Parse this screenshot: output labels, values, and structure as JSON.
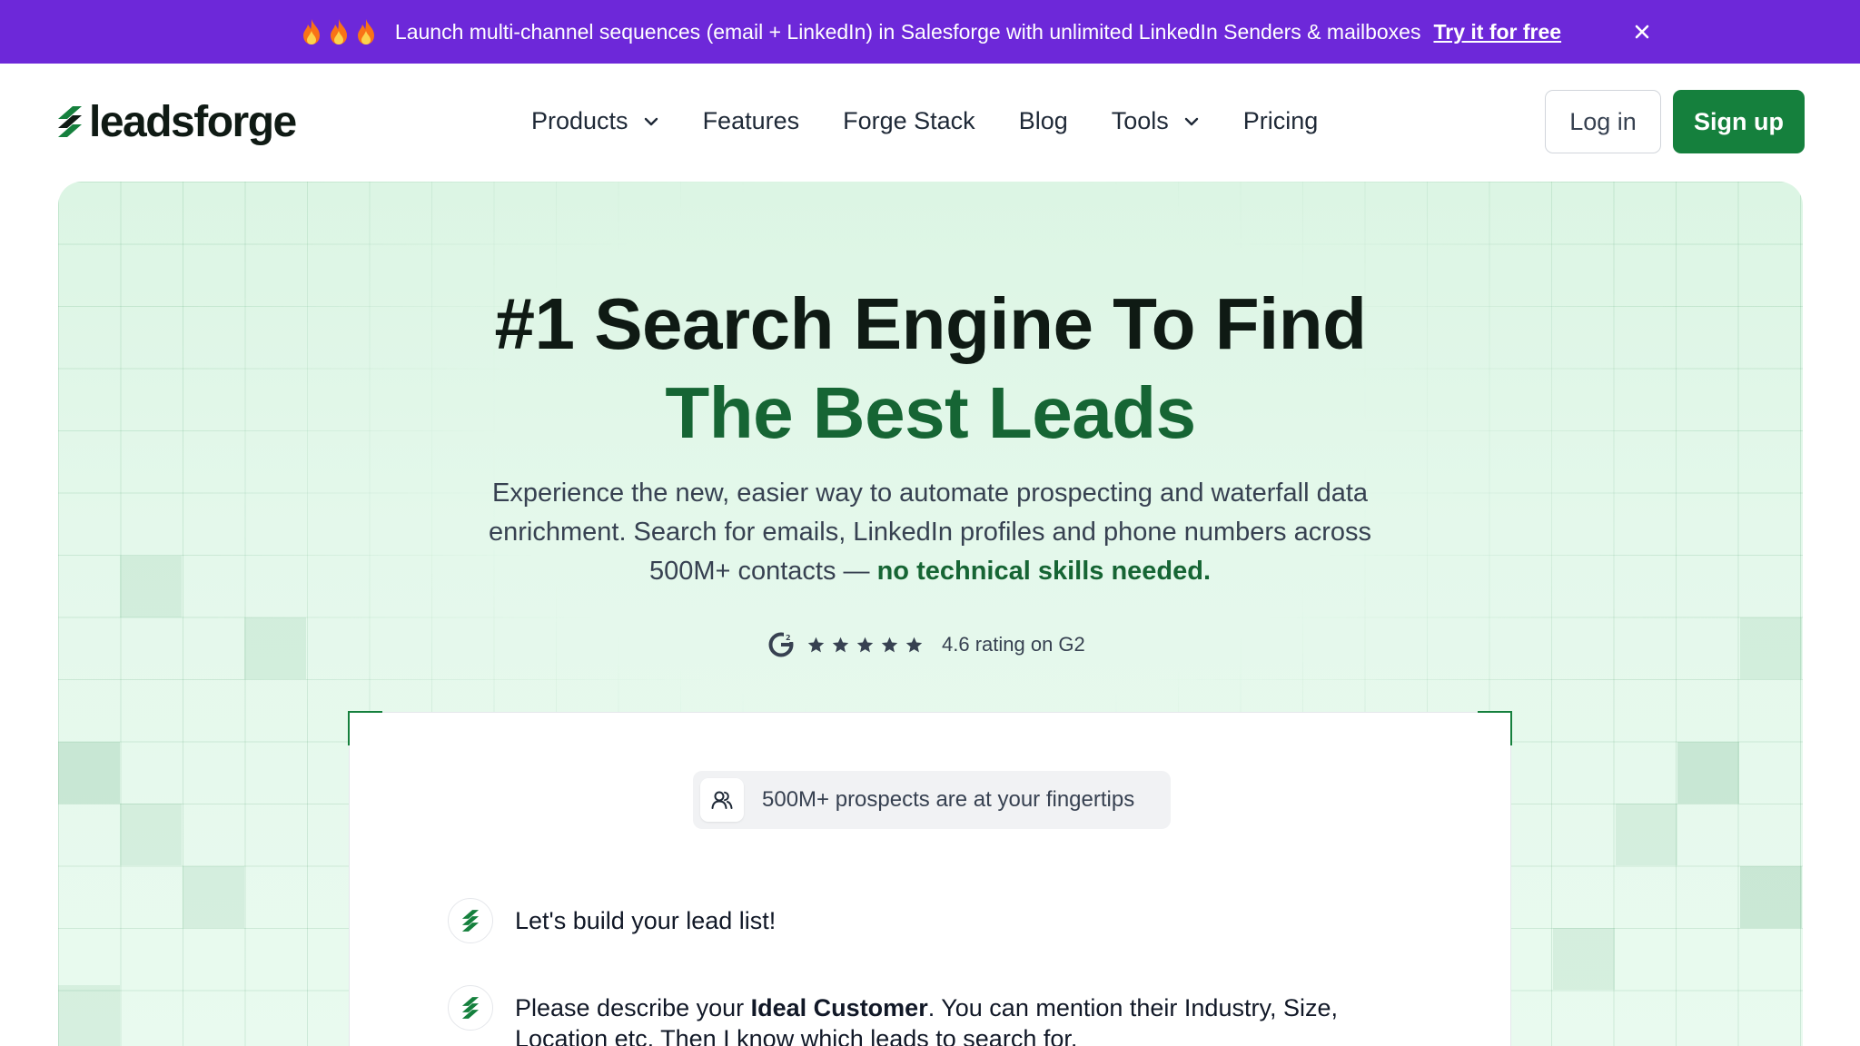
{
  "banner": {
    "icons": [
      "fire-icon",
      "fire-icon",
      "fire-icon"
    ],
    "text": "Launch multi-channel sequences (email + LinkedIn) in Salesforge with unlimited LinkedIn Senders & mailboxes",
    "cta": "Try it for free",
    "background": "#6d28d9"
  },
  "header": {
    "logo_text": "leadsforge",
    "nav": [
      {
        "label": "Products",
        "dropdown": true
      },
      {
        "label": "Features",
        "dropdown": false
      },
      {
        "label": "Forge Stack",
        "dropdown": false
      },
      {
        "label": "Blog",
        "dropdown": false
      },
      {
        "label": "Tools",
        "dropdown": true
      },
      {
        "label": "Pricing",
        "dropdown": false
      }
    ],
    "login_label": "Log in",
    "signup_label": "Sign up",
    "accent": "#15803d"
  },
  "hero": {
    "title_line1": "#1 Search Engine To Find",
    "title_line2": "The Best Leads",
    "subtitle": "Experience the new, easier way to automate prospecting and waterfall data enrichment. Search for emails, LinkedIn profiles and phone numbers across 500M+ contacts —",
    "subtitle_strong": "no technical skills needed.",
    "rating": {
      "stars": 5,
      "text": "4.6 rating on G2"
    }
  },
  "demo": {
    "pill_text": "500M+ prospects are at your fingertips",
    "messages": [
      {
        "text": "Let's build your lead list!"
      },
      {
        "text_before": "Please describe your",
        "text_bold": "Ideal Customer",
        "text_after": ". You can mention their Industry, Size, Location etc. Then I know which leads to search for."
      }
    ]
  }
}
